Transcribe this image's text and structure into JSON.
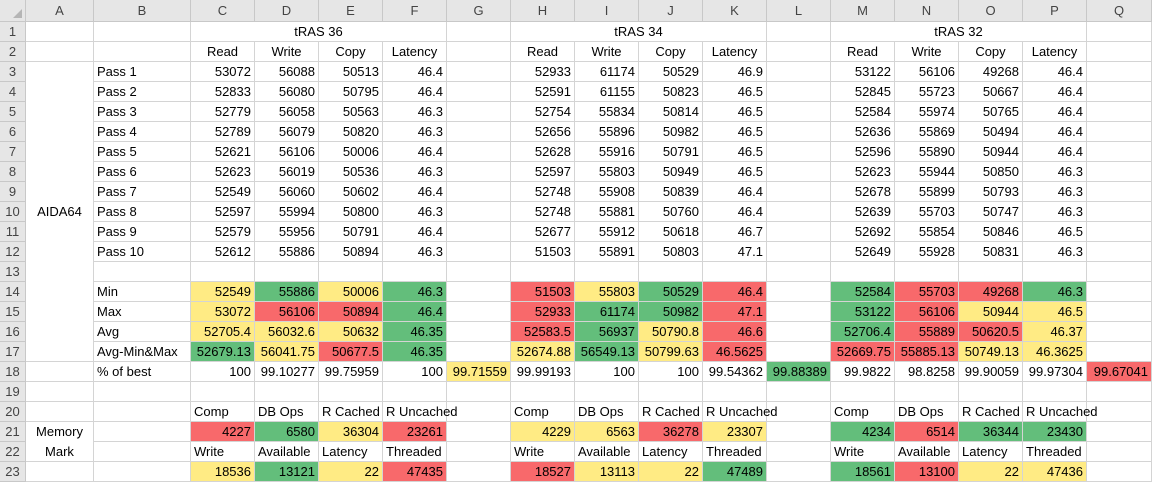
{
  "columns": [
    "A",
    "B",
    "C",
    "D",
    "E",
    "F",
    "G",
    "H",
    "I",
    "J",
    "K",
    "L",
    "M",
    "N",
    "O",
    "P",
    "Q"
  ],
  "rows": [
    "1",
    "2",
    "3",
    "4",
    "5",
    "6",
    "7",
    "8",
    "9",
    "10",
    "11",
    "12",
    "13",
    "14",
    "15",
    "16",
    "17",
    "18",
    "19",
    "20",
    "21",
    "22",
    "23"
  ],
  "group_titles": {
    "c": "tRAS 36",
    "h": "tRAS 34",
    "m": "tRAS 32"
  },
  "aida": {
    "label": "AIDA64",
    "headers": [
      "Read",
      "Write",
      "Copy",
      "Latency"
    ],
    "pass_labels": [
      "Pass 1",
      "Pass 2",
      "Pass 3",
      "Pass 4",
      "Pass 5",
      "Pass 6",
      "Pass 7",
      "Pass 8",
      "Pass 9",
      "Pass 10"
    ],
    "t36": [
      [
        "53072",
        "56088",
        "50513",
        "46.4"
      ],
      [
        "52833",
        "56080",
        "50795",
        "46.4"
      ],
      [
        "52779",
        "56058",
        "50563",
        "46.3"
      ],
      [
        "52789",
        "56079",
        "50820",
        "46.3"
      ],
      [
        "52621",
        "56106",
        "50006",
        "46.4"
      ],
      [
        "52623",
        "56019",
        "50536",
        "46.3"
      ],
      [
        "52549",
        "56060",
        "50602",
        "46.4"
      ],
      [
        "52597",
        "55994",
        "50800",
        "46.3"
      ],
      [
        "52579",
        "55956",
        "50791",
        "46.4"
      ],
      [
        "52612",
        "55886",
        "50894",
        "46.3"
      ]
    ],
    "t34": [
      [
        "52933",
        "61174",
        "50529",
        "46.9"
      ],
      [
        "52591",
        "61155",
        "50823",
        "46.5"
      ],
      [
        "52754",
        "55834",
        "50814",
        "46.5"
      ],
      [
        "52656",
        "55896",
        "50982",
        "46.5"
      ],
      [
        "52628",
        "55916",
        "50791",
        "46.5"
      ],
      [
        "52597",
        "55803",
        "50949",
        "46.5"
      ],
      [
        "52748",
        "55908",
        "50839",
        "46.4"
      ],
      [
        "52748",
        "55881",
        "50760",
        "46.4"
      ],
      [
        "52677",
        "55912",
        "50618",
        "46.7"
      ],
      [
        "51503",
        "55891",
        "50803",
        "47.1"
      ]
    ],
    "t32": [
      [
        "53122",
        "56106",
        "49268",
        "46.4"
      ],
      [
        "52845",
        "55723",
        "50667",
        "46.4"
      ],
      [
        "52584",
        "55974",
        "50765",
        "46.4"
      ],
      [
        "52636",
        "55869",
        "50494",
        "46.4"
      ],
      [
        "52596",
        "55890",
        "50944",
        "46.4"
      ],
      [
        "52623",
        "55944",
        "50850",
        "46.3"
      ],
      [
        "52678",
        "55899",
        "50793",
        "46.3"
      ],
      [
        "52639",
        "55703",
        "50747",
        "46.3"
      ],
      [
        "52692",
        "55854",
        "50846",
        "46.5"
      ],
      [
        "52649",
        "55928",
        "50831",
        "46.3"
      ]
    ]
  },
  "stats": {
    "labels": [
      "Min",
      "Max",
      "Avg",
      "Avg-Min&Max"
    ],
    "t36": [
      [
        "52549",
        "55886",
        "50006",
        "46.3"
      ],
      [
        "53072",
        "56106",
        "50894",
        "46.4"
      ],
      [
        "52705.4",
        "56032.6",
        "50632",
        "46.35"
      ],
      [
        "52679.13",
        "56041.75",
        "50677.5",
        "46.35"
      ]
    ],
    "t34": [
      [
        "51503",
        "55803",
        "50529",
        "46.4"
      ],
      [
        "52933",
        "61174",
        "50982",
        "47.1"
      ],
      [
        "52583.5",
        "56937",
        "50790.8",
        "46.6"
      ],
      [
        "52674.88",
        "56549.13",
        "50799.63",
        "46.5625"
      ]
    ],
    "t32": [
      [
        "52584",
        "55703",
        "49268",
        "46.3"
      ],
      [
        "53122",
        "56106",
        "50944",
        "46.5"
      ],
      [
        "52706.4",
        "55889",
        "50620.5",
        "46.37"
      ],
      [
        "52669.75",
        "55885.13",
        "50749.13",
        "46.3625"
      ]
    ],
    "colors": {
      "t36": [
        [
          "y",
          "g",
          "y",
          "g"
        ],
        [
          "y",
          "r",
          "r",
          "g"
        ],
        [
          "y",
          "y",
          "y",
          "g"
        ],
        [
          "g",
          "y",
          "r",
          "g"
        ]
      ],
      "t34": [
        [
          "r",
          "y",
          "g",
          "r"
        ],
        [
          "r",
          "g",
          "g",
          "r"
        ],
        [
          "r",
          "g",
          "y",
          "r"
        ],
        [
          "y",
          "g",
          "y",
          "r"
        ]
      ],
      "t32": [
        [
          "g",
          "r",
          "r",
          "g"
        ],
        [
          "g",
          "r",
          "y",
          "y"
        ],
        [
          "g",
          "r",
          "r",
          "y"
        ],
        [
          "r",
          "r",
          "y",
          "y"
        ]
      ]
    }
  },
  "pct": {
    "label": "% of best",
    "t36": [
      "100",
      "99.10277",
      "99.75959",
      "100"
    ],
    "t36_total": "99.71559",
    "t34": [
      "99.99193",
      "100",
      "100",
      "99.54362"
    ],
    "t34_total": "99.88389",
    "t32": [
      "99.9822",
      "98.8258",
      "99.90059",
      "99.97304"
    ],
    "t32_total": "99.67041",
    "colors": {
      "t36_total": "y",
      "t34_total": "g",
      "t32_total": "r"
    }
  },
  "memmark": {
    "label_line1": "Memory",
    "label_line2": "Mark",
    "headers1": [
      "Comp",
      "DB Ops",
      "R Cached",
      "R Uncached"
    ],
    "headers2": [
      "Write",
      "Available",
      "Latency",
      "Threaded"
    ],
    "t36": {
      "r21": [
        "4227",
        "6580",
        "36304",
        "23261"
      ],
      "r23": [
        "18536",
        "13121",
        "22",
        "47435"
      ]
    },
    "t34": {
      "r21": [
        "4229",
        "6563",
        "36278",
        "23307"
      ],
      "r23": [
        "18527",
        "13113",
        "22",
        "47489"
      ]
    },
    "t32": {
      "r21": [
        "4234",
        "6514",
        "36344",
        "23430"
      ],
      "r23": [
        "18561",
        "13100",
        "22",
        "47436"
      ]
    },
    "colors": {
      "t36": {
        "r21": [
          "r",
          "g",
          "y",
          "r"
        ],
        "r23": [
          "y",
          "g",
          "y",
          "r"
        ]
      },
      "t34": {
        "r21": [
          "y",
          "y",
          "r",
          "y"
        ],
        "r23": [
          "r",
          "y",
          "y",
          "g"
        ]
      },
      "t32": {
        "r21": [
          "g",
          "r",
          "g",
          "g"
        ],
        "r23": [
          "g",
          "r",
          "y",
          "y"
        ]
      }
    }
  }
}
